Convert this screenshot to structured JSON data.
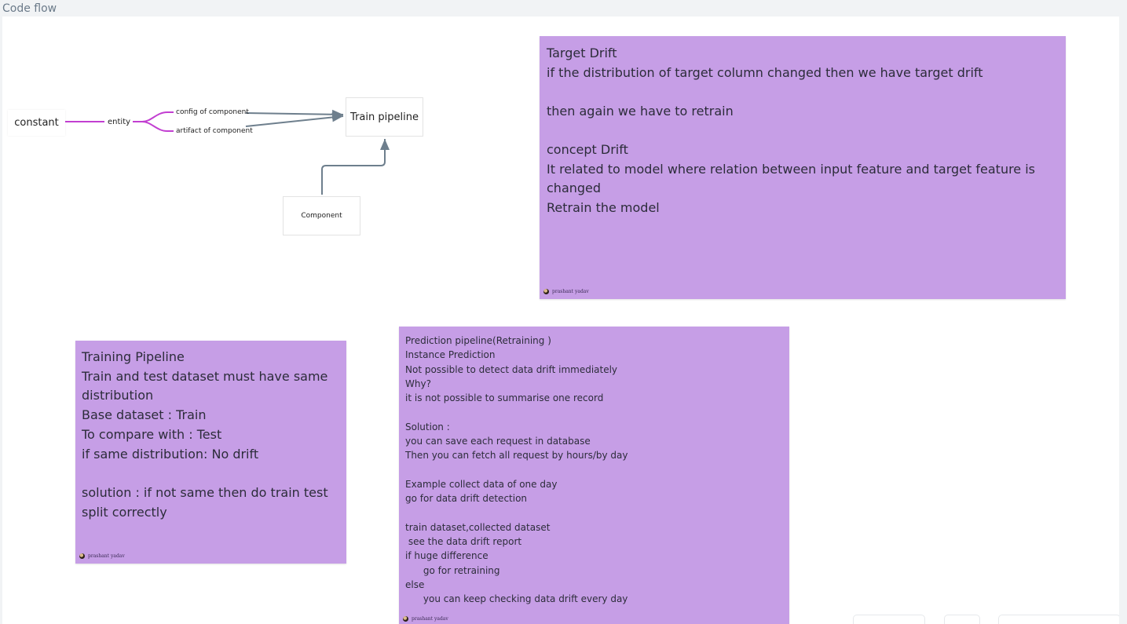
{
  "frame": {
    "title": "Code flow"
  },
  "diagram": {
    "constant_label": "constant",
    "entity_label": "entity",
    "branch_top": "config of component",
    "branch_bottom": "artifact of component",
    "train_pipeline_label": "Train pipeline",
    "component_label": "Component"
  },
  "notes": {
    "target_drift": {
      "text": "Target Drift\nif the distribution of target column changed then we have target drift\n\nthen again we have to retrain\n\nconcept Drift\nIt related to model where relation between input feature and target feature is changed\nRetrain the model",
      "author": "prashant yadav"
    },
    "training_pipeline": {
      "text": "Training Pipeline\nTrain and test dataset must have same distribution\nBase dataset : Train\nTo compare with : Test\nif same distribution: No drift\n\nsolution : if not same then do train test split correctly",
      "author": "prashant yadav"
    },
    "prediction_pipeline": {
      "text": "Prediction pipeline(Retraining )\nInstance Prediction\nNot possible to detect data drift immediately\nWhy?\nit is not possible to summarise one record\n\nSolution :\nyou can save each request in database\nThen you can fetch all request by hours/by day\n\nExample collect data of one day\ngo for data drift detection\n\ntrain dataset,collected dataset\n see the data drift report\nif huge difference\n      go for retraining\nelse\n      you can keep checking data drift every day",
      "author": "prashant yadav"
    }
  },
  "colors": {
    "sticky": "#c69ee6",
    "mindmap_branch": "#c23fd1",
    "connector": "#6e7f8d"
  }
}
